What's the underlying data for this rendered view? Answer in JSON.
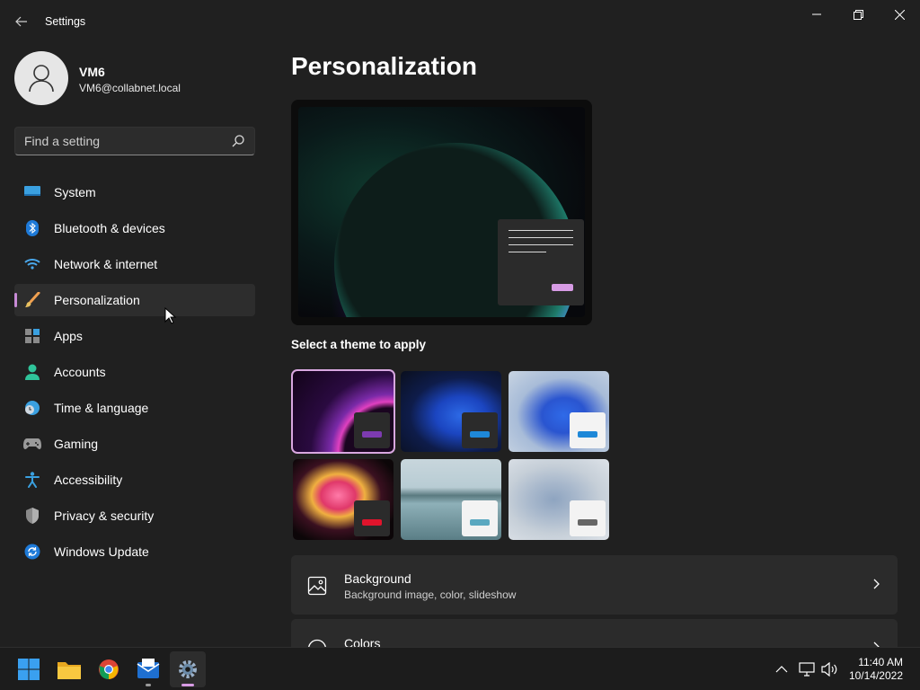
{
  "window": {
    "title": "Settings"
  },
  "user": {
    "name": "VM6",
    "email": "VM6@collabnet.local"
  },
  "search": {
    "placeholder": "Find a setting"
  },
  "sidebar": {
    "items": [
      {
        "label": "System",
        "icon": "system-icon"
      },
      {
        "label": "Bluetooth & devices",
        "icon": "bluetooth-icon"
      },
      {
        "label": "Network & internet",
        "icon": "wifi-icon"
      },
      {
        "label": "Personalization",
        "icon": "brush-icon",
        "active": true
      },
      {
        "label": "Apps",
        "icon": "apps-icon"
      },
      {
        "label": "Accounts",
        "icon": "accounts-icon"
      },
      {
        "label": "Time & language",
        "icon": "clock-globe-icon"
      },
      {
        "label": "Gaming",
        "icon": "gamepad-icon"
      },
      {
        "label": "Accessibility",
        "icon": "accessibility-icon"
      },
      {
        "label": "Privacy & security",
        "icon": "shield-icon"
      },
      {
        "label": "Windows Update",
        "icon": "update-icon"
      }
    ]
  },
  "main": {
    "title": "Personalization",
    "themes_label": "Select a theme to apply",
    "themes": [
      {
        "name": "theme-glow-dark",
        "selected": true
      },
      {
        "name": "theme-bloom-dark"
      },
      {
        "name": "theme-bloom-light"
      },
      {
        "name": "theme-captured-motion"
      },
      {
        "name": "theme-sunrise-lake"
      },
      {
        "name": "theme-flow"
      }
    ],
    "cards": [
      {
        "title": "Background",
        "subtitle": "Background image, color, slideshow",
        "icon": "image-icon"
      },
      {
        "title": "Colors",
        "subtitle": "",
        "icon": "palette-icon"
      }
    ]
  },
  "taskbar": {
    "apps": [
      "start-icon",
      "file-explorer-icon",
      "chrome-icon",
      "mail-icon",
      "settings-icon"
    ],
    "clock": {
      "time": "11:40 AM",
      "date": "10/14/2022"
    }
  },
  "colors": {
    "accent": "#d79be4",
    "background": "#202020",
    "card": "#2b2b2b"
  }
}
